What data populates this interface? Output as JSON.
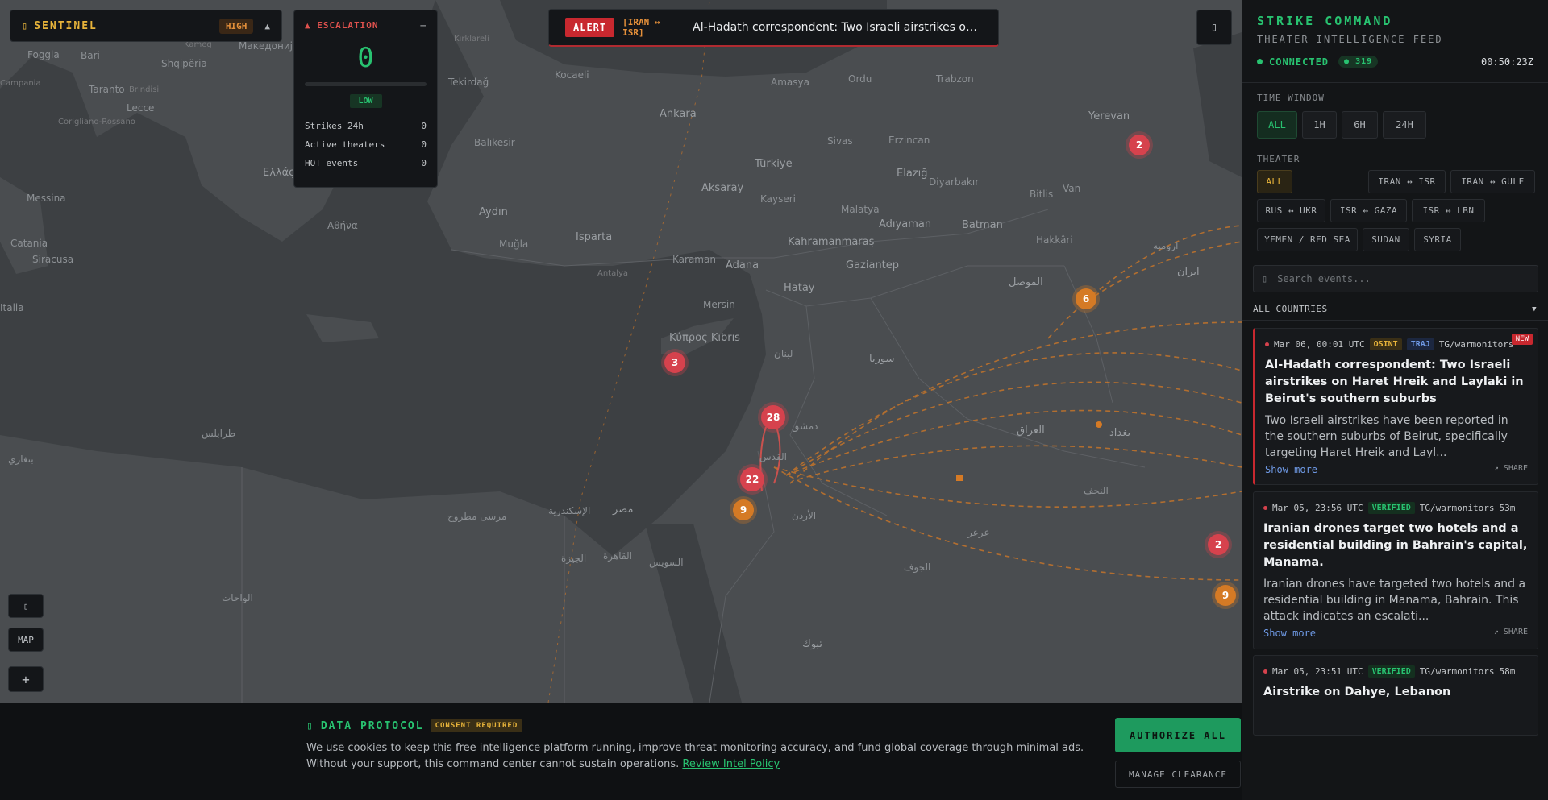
{
  "brand": {
    "title": "SENTINEL",
    "threat_level": "HIGH",
    "caret": "▲"
  },
  "escalation": {
    "title": "▲ ESCALATION",
    "collapse": "–",
    "score": "0",
    "level": "LOW",
    "stats": [
      {
        "label": "Strikes 24h",
        "value": "0"
      },
      {
        "label": "Active theaters",
        "value": "0"
      },
      {
        "label": "HOT events",
        "value": "0"
      }
    ]
  },
  "alert": {
    "tag": "ALERT",
    "route": "[IRAN ↔ ISR]",
    "text": "Al-Hadath correspondent: Two Israeli airstrikes on..."
  },
  "map_controls": {
    "layers_icon": "layers-icon",
    "map_label": "MAP",
    "zoom_in": "+"
  },
  "map": {
    "labels": [
      "Foggia",
      "Bari",
      "Shqipëria",
      "Taranto",
      "Brindisi",
      "Lecce",
      "Corigliano-Rossano",
      "Messina",
      "Catania",
      "Siracusa",
      "Campania",
      "Italia",
      "Kameg",
      "Македонија",
      "Ελλάς",
      "Αθήνα",
      "Kırklareli",
      "Tekirdağ",
      "Kocaeli",
      "Balıkesir",
      "Ankara",
      "Amasya",
      "Ordu",
      "Trabzon",
      "Türkiye",
      "Aksaray",
      "Kayseri",
      "Sivas",
      "Erzincan",
      "Elazığ",
      "Malatya",
      "Batman",
      "Diyarbakır",
      "Adıyaman",
      "Kahramanmaraş",
      "Gaziantep",
      "Aydın",
      "Isparta",
      "Karaman",
      "Adana",
      "Mersin",
      "Antalya",
      "Hatay",
      "Muğla",
      "Κύπρος Kıbrıs",
      "سوريا",
      "الموصل",
      "العراق",
      "لبنان",
      "دمشق",
      "الأردن",
      "القدس",
      "مصر",
      "الإسكندرية",
      "القاهرة",
      "السويس",
      "الجيزة",
      "مرسى مطروح",
      "طرابلس",
      "بنغازي",
      "الواحات",
      "تبوك",
      "الجوف",
      "عرعر",
      "النجف",
      "بغداد",
      "Van",
      "Bitlis",
      "Hakkâri",
      "ایران",
      "ارومیه",
      "Yerevan"
    ],
    "clusters": [
      {
        "count": "2",
        "color": "red"
      },
      {
        "count": "6",
        "color": "orange"
      },
      {
        "count": "3",
        "color": "red"
      },
      {
        "count": "28",
        "color": "red"
      },
      {
        "count": "22",
        "color": "red"
      },
      {
        "count": "9",
        "color": "orange"
      },
      {
        "count": "2",
        "color": "red"
      },
      {
        "count": "9",
        "color": "orange"
      }
    ]
  },
  "sidebar": {
    "title": "STRIKE COMMAND",
    "subtitle": "THEATER INTELLIGENCE FEED",
    "status": "CONNECTED",
    "count": "319",
    "clock": "00:50:23Z",
    "time_window_label": "TIME WINDOW",
    "time_windows": [
      "ALL",
      "1H",
      "6H",
      "24H"
    ],
    "theater_label": "THEATER",
    "theaters": [
      "ALL",
      "IRAN ↔ ISR",
      "IRAN ↔ GULF",
      "RUS ↔ UKR",
      "ISR ↔ GAZA",
      "ISR ↔ LBN",
      "YEMEN / RED SEA",
      "SUDAN",
      "SYRIA"
    ],
    "search_placeholder": "Search events...",
    "countries_label": "ALL COUNTRIES",
    "events": [
      {
        "time": "Mar 06, 00:01 UTC",
        "badge1": "OSINT",
        "badge2": "TRAJ",
        "source": "TG/warmonitors",
        "new": "NEW",
        "title": "Al-Hadath correspondent: Two Israeli airstrikes on Haret Hreik and Laylaki in Beirut's southern suburbs",
        "body": "Two Israeli airstrikes have been reported in the southern suburbs of Beirut, specifically targeting Haret Hreik and Layl...",
        "more": "Show more",
        "share": "↗ SHARE"
      },
      {
        "time": "Mar 05, 23:56 UTC",
        "badge1": "VERIFIED",
        "source": "TG/warmonitors",
        "age": "53m",
        "title": " Iranian drones target two hotels and a residential building in Bahrain's capital, Manama.",
        "body": "Iranian drones have targeted two hotels and a residential building in Manama, Bahrain. This attack indicates an escalati...",
        "more": "Show more",
        "share": "↗ SHARE"
      },
      {
        "time": "Mar 05, 23:51 UTC",
        "badge1": "VERIFIED",
        "source": "TG/warmonitors",
        "age": "58m",
        "title": "Airstrike on Dahye, Lebanon"
      }
    ]
  },
  "consent": {
    "title": "DATA PROTOCOL",
    "required": "CONSENT REQUIRED",
    "body": "We use cookies to keep this free intelligence platform running, improve threat monitoring accuracy, and fund global coverage through minimal ads. Without your support, this command center cannot sustain operations.",
    "link": "Review Intel Policy",
    "authorize": "AUTHORIZE ALL",
    "manage": "MANAGE CLEARANCE"
  }
}
